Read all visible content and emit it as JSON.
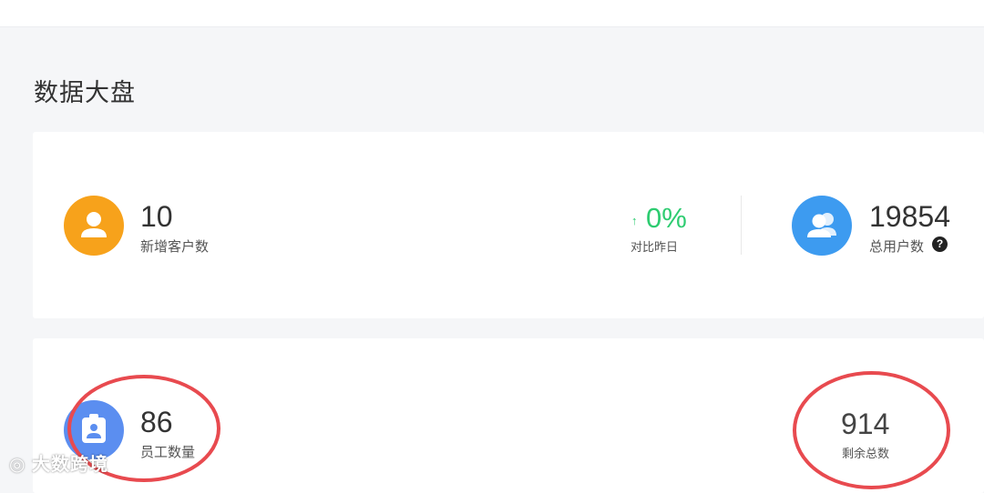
{
  "page": {
    "title": "数据大盘"
  },
  "stats": {
    "new_customers": {
      "value": "10",
      "label": "新增客户数",
      "icon": "user-icon",
      "color": "#f7a21b"
    },
    "compare": {
      "arrow": "↑",
      "value": "0%",
      "label": "对比昨日",
      "color": "#2ecc71"
    },
    "total_users": {
      "value": "19854",
      "label": "总用户数",
      "icon": "users-icon",
      "color": "#3d9bf0",
      "help": "?"
    },
    "employees": {
      "value": "86",
      "label": "员工数量",
      "icon": "badge-icon",
      "color": "#5b8ef0"
    },
    "remaining": {
      "value": "914",
      "label": "剩余总数"
    }
  },
  "annotations": {
    "color": "#e84a4f"
  },
  "watermark": {
    "text": "大数跨境"
  }
}
